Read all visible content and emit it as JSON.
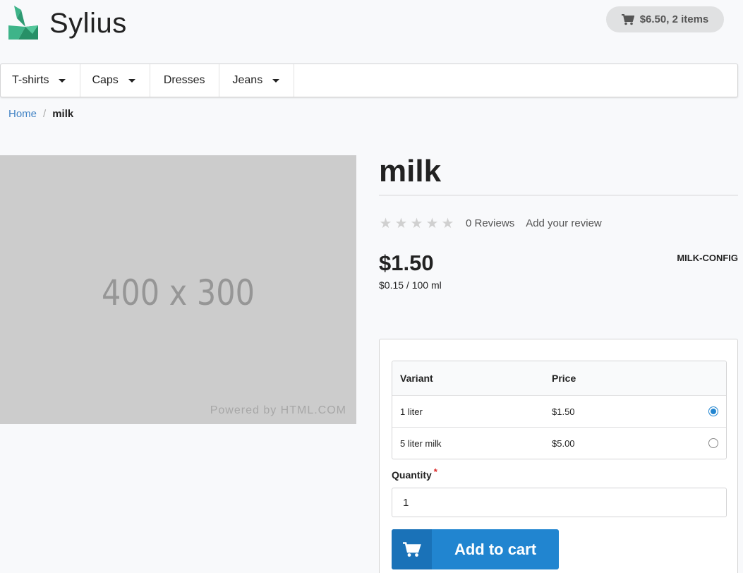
{
  "header": {
    "logo_text": "Sylius",
    "cart_summary": "$6.50, 2 items"
  },
  "nav": {
    "items": [
      {
        "label": "T-shirts",
        "has_dropdown": true
      },
      {
        "label": "Caps",
        "has_dropdown": true
      },
      {
        "label": "Dresses",
        "has_dropdown": false
      },
      {
        "label": "Jeans",
        "has_dropdown": true
      }
    ]
  },
  "breadcrumb": {
    "home": "Home",
    "divider": "/",
    "current": "milk"
  },
  "image": {
    "placeholder_text": "400 x 300",
    "powered_by": "Powered by HTML.COM"
  },
  "product": {
    "name": "milk",
    "reviews_count": "0 Reviews",
    "add_review": "Add your review",
    "rating": 0,
    "price": "$1.50",
    "unit_price": "$0.15 / 100 ml",
    "sku": "MILK-CONFIG"
  },
  "variants": {
    "headers": {
      "variant": "Variant",
      "price": "Price"
    },
    "rows": [
      {
        "name": "1 liter",
        "price": "$1.50",
        "selected": true
      },
      {
        "name": "5 liter milk",
        "price": "$5.00",
        "selected": false
      }
    ]
  },
  "quantity": {
    "label": "Quantity",
    "required_mark": "*",
    "value": "1"
  },
  "add_to_cart": {
    "label": "Add to cart",
    "icon": "cart-icon"
  },
  "colors": {
    "primary": "#2185d0",
    "link": "#4183c4",
    "logo": "#3eb489"
  }
}
